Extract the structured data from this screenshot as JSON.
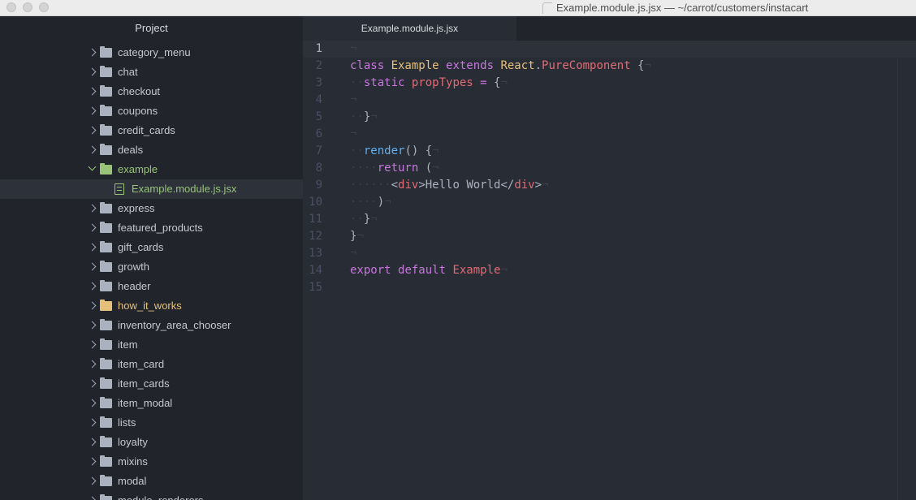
{
  "window": {
    "title": "Example.module.js.jsx — ~/carrot/customers/instacart"
  },
  "sidebar": {
    "header": "Project",
    "items": [
      {
        "label": "category_menu",
        "type": "folder",
        "state": "closed"
      },
      {
        "label": "chat",
        "type": "folder",
        "state": "closed"
      },
      {
        "label": "checkout",
        "type": "folder",
        "state": "closed"
      },
      {
        "label": "coupons",
        "type": "folder",
        "state": "closed"
      },
      {
        "label": "credit_cards",
        "type": "folder",
        "state": "closed"
      },
      {
        "label": "deals",
        "type": "folder",
        "state": "closed"
      },
      {
        "label": "example",
        "type": "folder",
        "state": "open"
      },
      {
        "label": "Example.module.js.jsx",
        "type": "file",
        "state": "selected"
      },
      {
        "label": "express",
        "type": "folder",
        "state": "closed"
      },
      {
        "label": "featured_products",
        "type": "folder",
        "state": "closed"
      },
      {
        "label": "gift_cards",
        "type": "folder",
        "state": "closed"
      },
      {
        "label": "growth",
        "type": "folder",
        "state": "closed"
      },
      {
        "label": "header",
        "type": "folder",
        "state": "closed"
      },
      {
        "label": "how_it_works",
        "type": "folder",
        "state": "modified"
      },
      {
        "label": "inventory_area_chooser",
        "type": "folder",
        "state": "closed"
      },
      {
        "label": "item",
        "type": "folder",
        "state": "closed"
      },
      {
        "label": "item_card",
        "type": "folder",
        "state": "closed"
      },
      {
        "label": "item_cards",
        "type": "folder",
        "state": "closed"
      },
      {
        "label": "item_modal",
        "type": "folder",
        "state": "closed"
      },
      {
        "label": "lists",
        "type": "folder",
        "state": "closed"
      },
      {
        "label": "loyalty",
        "type": "folder",
        "state": "closed"
      },
      {
        "label": "mixins",
        "type": "folder",
        "state": "closed"
      },
      {
        "label": "modal",
        "type": "folder",
        "state": "closed"
      },
      {
        "label": "module_renderers",
        "type": "folder",
        "state": "closed"
      }
    ]
  },
  "editor": {
    "tab_label": "Example.module.js.jsx",
    "cursor_line": 1,
    "lines": [
      {
        "num": "1",
        "tokens": [
          {
            "t": "¬",
            "c": "inv"
          }
        ]
      },
      {
        "num": "2",
        "tokens": [
          {
            "t": "class ",
            "c": "kw"
          },
          {
            "t": "Example ",
            "c": "cls"
          },
          {
            "t": "extends ",
            "c": "kw"
          },
          {
            "t": "React",
            "c": "cls"
          },
          {
            "t": ".",
            "c": "plain"
          },
          {
            "t": "PureComponent",
            "c": "prop"
          },
          {
            "t": " {",
            "c": "plain"
          },
          {
            "t": "¬",
            "c": "inv"
          }
        ]
      },
      {
        "num": "3",
        "tokens": [
          {
            "t": "··",
            "c": "inv"
          },
          {
            "t": "static ",
            "c": "kw"
          },
          {
            "t": "propTypes ",
            "c": "prop"
          },
          {
            "t": "= ",
            "c": "kw"
          },
          {
            "t": "{",
            "c": "plain"
          },
          {
            "t": "¬",
            "c": "inv"
          }
        ]
      },
      {
        "num": "4",
        "tokens": [
          {
            "t": "¬",
            "c": "inv"
          }
        ]
      },
      {
        "num": "5",
        "tokens": [
          {
            "t": "··",
            "c": "inv"
          },
          {
            "t": "}",
            "c": "plain"
          },
          {
            "t": "¬",
            "c": "inv"
          }
        ]
      },
      {
        "num": "6",
        "tokens": [
          {
            "t": "¬",
            "c": "inv"
          }
        ]
      },
      {
        "num": "7",
        "tokens": [
          {
            "t": "··",
            "c": "inv"
          },
          {
            "t": "render",
            "c": "fn"
          },
          {
            "t": "() {",
            "c": "plain"
          },
          {
            "t": "¬",
            "c": "inv"
          }
        ]
      },
      {
        "num": "8",
        "tokens": [
          {
            "t": "····",
            "c": "inv"
          },
          {
            "t": "return ",
            "c": "kw"
          },
          {
            "t": "(",
            "c": "plain"
          },
          {
            "t": "¬",
            "c": "inv"
          }
        ]
      },
      {
        "num": "9",
        "tokens": [
          {
            "t": "······",
            "c": "inv"
          },
          {
            "t": "<",
            "c": "plain"
          },
          {
            "t": "div",
            "c": "tag"
          },
          {
            "t": ">Hello World</",
            "c": "plain"
          },
          {
            "t": "div",
            "c": "tag"
          },
          {
            "t": ">",
            "c": "plain"
          },
          {
            "t": "¬",
            "c": "inv"
          }
        ]
      },
      {
        "num": "10",
        "tokens": [
          {
            "t": "····",
            "c": "inv"
          },
          {
            "t": ")",
            "c": "plain"
          },
          {
            "t": "¬",
            "c": "inv"
          }
        ]
      },
      {
        "num": "11",
        "tokens": [
          {
            "t": "··",
            "c": "inv"
          },
          {
            "t": "}",
            "c": "plain"
          },
          {
            "t": "¬",
            "c": "inv"
          }
        ]
      },
      {
        "num": "12",
        "tokens": [
          {
            "t": "}",
            "c": "plain"
          },
          {
            "t": "¬",
            "c": "inv"
          }
        ]
      },
      {
        "num": "13",
        "tokens": [
          {
            "t": "¬",
            "c": "inv"
          }
        ]
      },
      {
        "num": "14",
        "tokens": [
          {
            "t": "export ",
            "c": "kw"
          },
          {
            "t": "default ",
            "c": "kw"
          },
          {
            "t": "Example",
            "c": "prop"
          },
          {
            "t": "¬",
            "c": "inv"
          }
        ]
      },
      {
        "num": "15",
        "tokens": []
      }
    ]
  },
  "colors": {
    "sidebar_bg": "#21252b",
    "editor_bg": "#282c34",
    "accent_green": "#98c379",
    "accent_yellow": "#e5c07b",
    "keyword_purple": "#c678dd"
  }
}
